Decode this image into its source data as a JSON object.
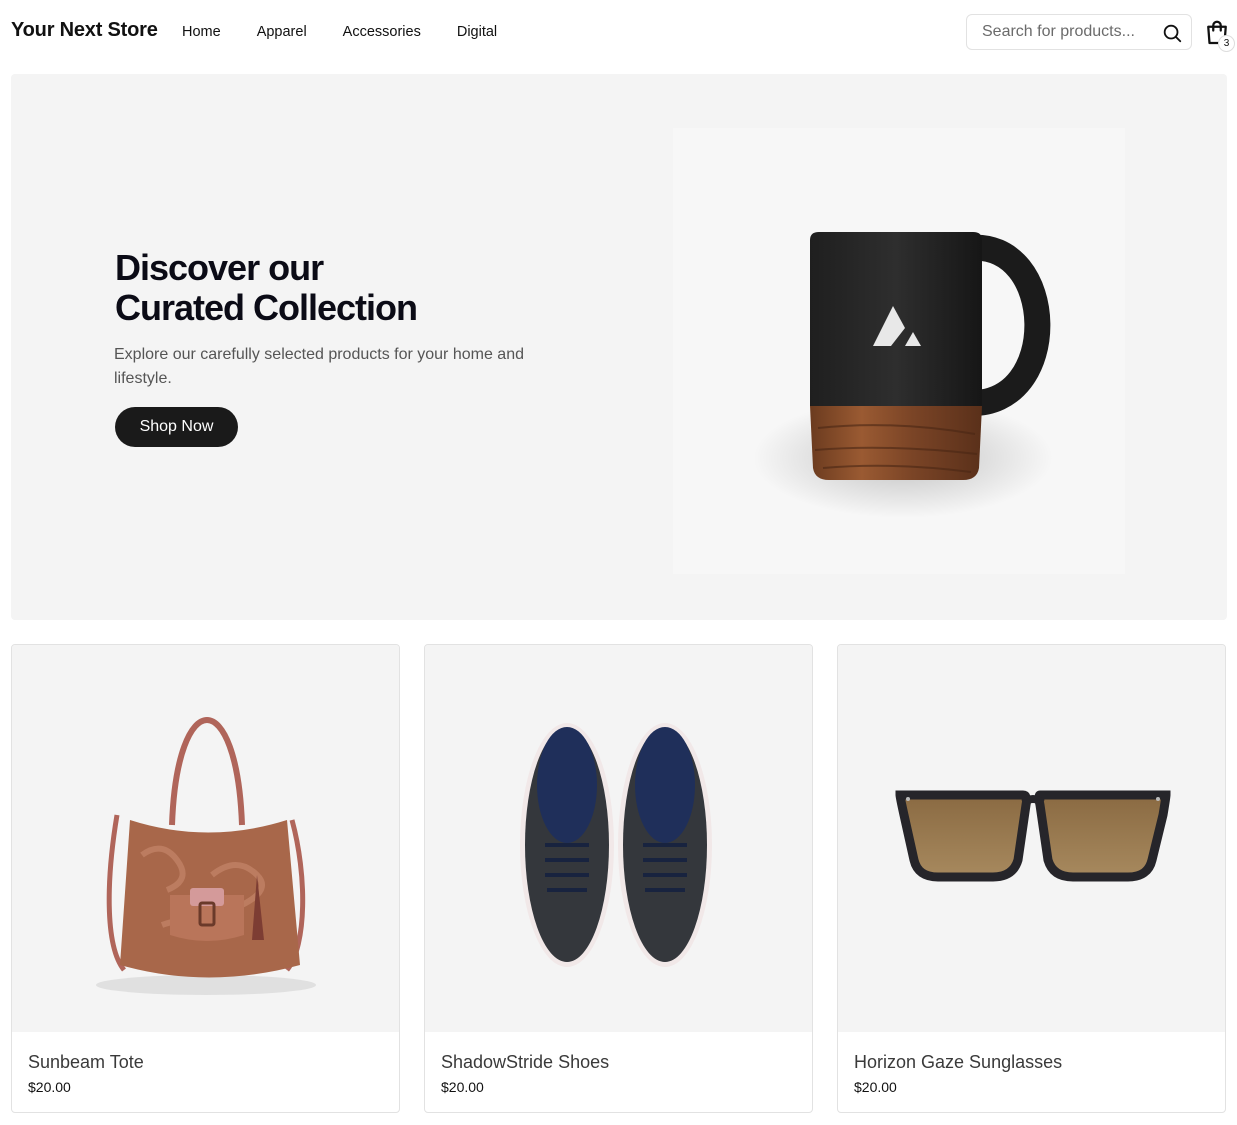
{
  "header": {
    "brand": "Your Next Store",
    "nav": [
      "Home",
      "Apparel",
      "Accessories",
      "Digital"
    ],
    "search_placeholder": "Search for products...",
    "cart_count": "3"
  },
  "hero": {
    "title_line1": "Discover our",
    "title_line2": "Curated Collection",
    "subtitle": "Explore our carefully selected products for your home and lifestyle.",
    "cta": "Shop Now"
  },
  "products": [
    {
      "name": "Sunbeam Tote",
      "price": "$20.00"
    },
    {
      "name": "ShadowStride Shoes",
      "price": "$20.00"
    },
    {
      "name": "Horizon Gaze Sunglasses",
      "price": "$20.00"
    }
  ],
  "colors": {
    "hero_bg": "#f4f4f4",
    "button_bg": "#1a1a1a",
    "text_dark": "#0b0b16",
    "border": "#e2e2e2"
  }
}
